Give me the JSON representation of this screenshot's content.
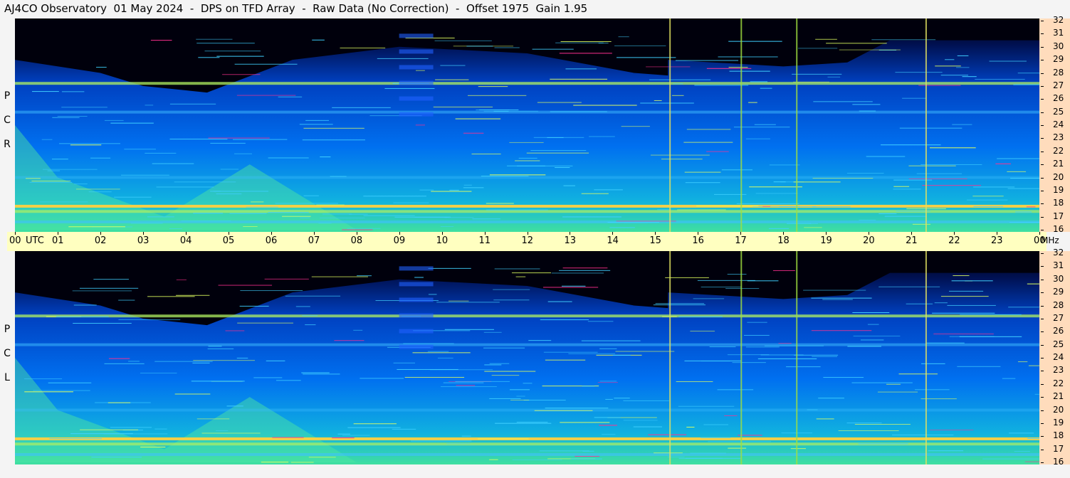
{
  "title": "AJ4CO Observatory  01 May 2024  -  DPS on TFD Array  -  Raw Data (No Correction)  -  Offset 1975  Gain 1.95",
  "channels": {
    "top": [
      "R",
      "C",
      "P"
    ],
    "bottom": [
      "L",
      "C",
      "P"
    ]
  },
  "time_axis": {
    "labels": [
      "00",
      "01",
      "02",
      "03",
      "04",
      "05",
      "06",
      "07",
      "08",
      "09",
      "10",
      "11",
      "12",
      "13",
      "14",
      "15",
      "16",
      "17",
      "18",
      "19",
      "20",
      "21",
      "22",
      "23",
      "00"
    ],
    "utc_label": "UTC",
    "freq_unit": "MHz"
  },
  "freq_axis": {
    "labels": [
      "32",
      "31",
      "30",
      "29",
      "28",
      "27",
      "26",
      "25",
      "24",
      "23",
      "22",
      "21",
      "20",
      "19",
      "18",
      "17",
      "16"
    ]
  },
  "chart_data": [
    {
      "type": "heatmap",
      "channel": "RCP",
      "x": {
        "range": [
          0,
          24
        ],
        "unit": "hours UTC"
      },
      "y": {
        "range": [
          16,
          32
        ],
        "unit": "MHz"
      },
      "bands": [
        {
          "freq": 27.2,
          "strength": 0.75
        },
        {
          "freq": 25.0,
          "strength": 0.5
        },
        {
          "freq": 20.0,
          "strength": 0.35
        },
        {
          "freq": 17.8,
          "strength": 0.95
        },
        {
          "freq": 17.4,
          "strength": 0.7
        },
        {
          "freq": 16.6,
          "strength": 0.6
        }
      ],
      "vertical_lines": [
        15.33,
        17.0,
        18.3,
        21.33
      ],
      "colors": {
        "low": "#000010",
        "mid": "#0050ff",
        "high": "#ffff40",
        "peak": "#ff2080"
      }
    },
    {
      "type": "heatmap",
      "channel": "LCP",
      "x": {
        "range": [
          0,
          24
        ],
        "unit": "hours UTC"
      },
      "y": {
        "range": [
          16,
          32
        ],
        "unit": "MHz"
      },
      "bands": [
        {
          "freq": 27.2,
          "strength": 0.75
        },
        {
          "freq": 25.0,
          "strength": 0.5
        },
        {
          "freq": 20.0,
          "strength": 0.35
        },
        {
          "freq": 17.8,
          "strength": 0.95
        },
        {
          "freq": 17.4,
          "strength": 0.7
        },
        {
          "freq": 16.6,
          "strength": 0.6
        }
      ],
      "vertical_lines": [
        15.33,
        17.0,
        18.3,
        21.33
      ],
      "colors": {
        "low": "#000010",
        "mid": "#0050ff",
        "high": "#ffff40",
        "peak": "#ff2080"
      }
    }
  ]
}
